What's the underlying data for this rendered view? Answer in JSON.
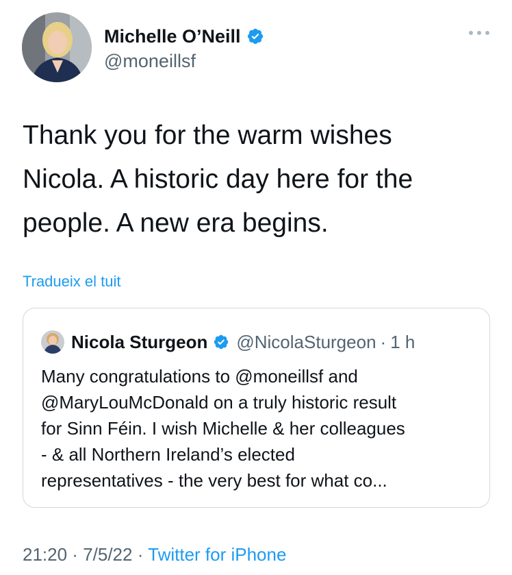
{
  "author": {
    "name": "Michelle O’Neill",
    "handle": "@moneillsf",
    "verified": true
  },
  "tweet": {
    "text": "Thank you for the warm wishes\nNicola. A historic day here for the\npeople. A new era begins.",
    "translate_label": "Tradueix el tuit"
  },
  "quoted_tweet": {
    "name": "Nicola Sturgeon",
    "handle": "@NicolaSturgeon",
    "separator": "·",
    "time": "1 h",
    "verified": true,
    "text": "Many congratulations to @moneillsf and\n@MaryLouMcDonald on a truly historic result\nfor Sinn Féin. I wish Michelle & her colleagues\n- & all Northern Ireland’s elected\nrepresentatives - the very best for what co..."
  },
  "meta": {
    "time": "21:20",
    "separator1": " · ",
    "date": "7/5/22",
    "separator2": " · ",
    "source": "Twitter for iPhone"
  },
  "icons": {
    "verified": "verified-badge-icon",
    "more": "more-dots-icon"
  },
  "colors": {
    "accent": "#1d9bf0",
    "text_primary": "#0f1419",
    "text_secondary": "#536471",
    "border": "#cfd9de"
  }
}
